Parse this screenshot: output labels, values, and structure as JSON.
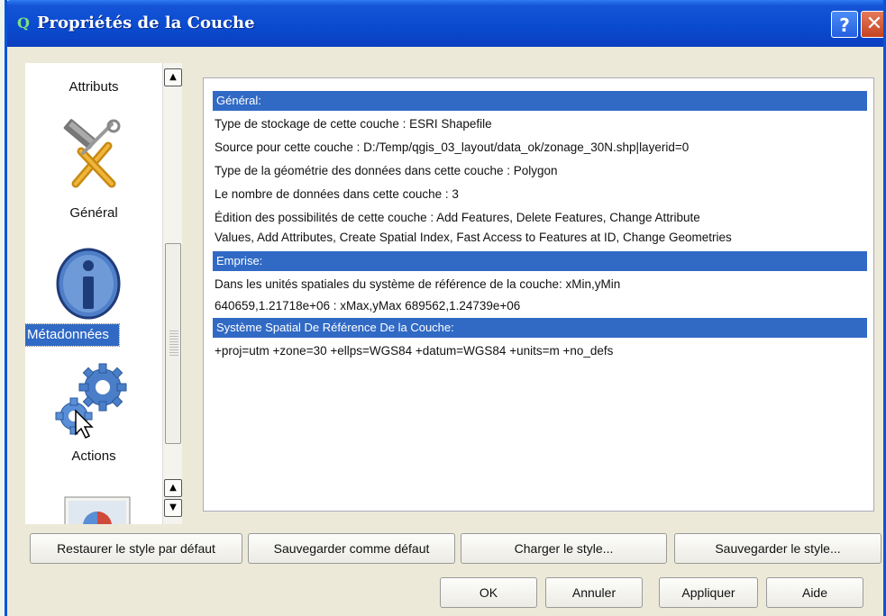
{
  "window": {
    "title": "Propriétés de la Couche",
    "app_icon": "qgis-q-icon",
    "help_label": "?",
    "close_label": "✕"
  },
  "sidebar": {
    "items": [
      {
        "label": "Attributs",
        "icon": "attributes-icon"
      },
      {
        "label": "Général",
        "icon": "tools-icon"
      },
      {
        "label": "Métadonnées",
        "icon": "info-icon",
        "selected": true
      },
      {
        "label": "Actions",
        "icon": "gears-icon"
      },
      {
        "label": "",
        "icon": "map-icon"
      }
    ]
  },
  "metadata": {
    "general": {
      "header": "Général:",
      "lines": [
        "Type de stockage de cette couche : ESRI Shapefile",
        "Source pour cette couche : D:/Temp/qgis_03_layout/data_ok/zonage_30N.shp|layerid=0",
        "Type de la géométrie des données dans cette couche : Polygon",
        "Le nombre de données dans cette couche : 3",
        "Édition des possibilités de cette couche : Add Features, Delete Features, Change Attribute",
        "Values, Add Attributes, Create Spatial Index, Fast Access to Features at ID, Change Geometries"
      ]
    },
    "extent": {
      "header": "Emprise:",
      "lines": [
        "Dans les unités spatiales du système de référence de la couche: xMin,yMin",
        "640659,1.21718e+06 : xMax,yMax 689562,1.24739e+06"
      ]
    },
    "srs": {
      "header": "Système Spatial De Référence De la Couche:",
      "lines": [
        "+proj=utm +zone=30 +ellps=WGS84 +datum=WGS84 +units=m +no_defs"
      ]
    }
  },
  "style_buttons": {
    "restore": "Restaurer le style par défaut",
    "save_default": "Sauvegarder comme défaut",
    "load": "Charger le style...",
    "save": "Sauvegarder le style..."
  },
  "dialog_buttons": {
    "ok": "OK",
    "cancel": "Annuler",
    "apply": "Appliquer",
    "help": "Aide"
  },
  "colors": {
    "selection": "#316ac5",
    "titlebar": "#0a4bd0",
    "dialog_bg": "#ece9d8"
  }
}
